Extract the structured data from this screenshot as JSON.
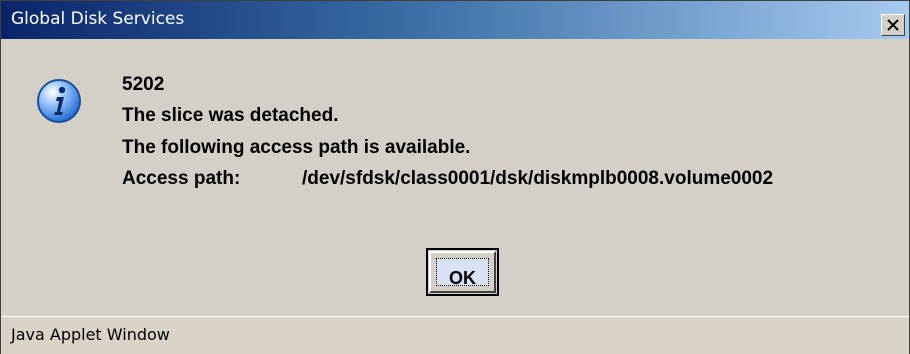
{
  "window": {
    "title": "Global Disk Services",
    "close_glyph": "X"
  },
  "message": {
    "code": "5202",
    "line1": "The slice was detached.",
    "line2": "The following access path is available.",
    "path_label": "Access path:",
    "path_value": "/dev/sfdsk/class0001/dsk/diskmplb0008.volume0002",
    "icon": "info-icon"
  },
  "buttons": {
    "ok_label": "OK"
  },
  "status_bar": {
    "text": "Java Applet Window"
  },
  "colors": {
    "title_gradient_start": "#0a246a",
    "title_gradient_end": "#a6caf0",
    "dialog_background": "#d4d0c8",
    "icon_blue": "#2b6fd6"
  }
}
